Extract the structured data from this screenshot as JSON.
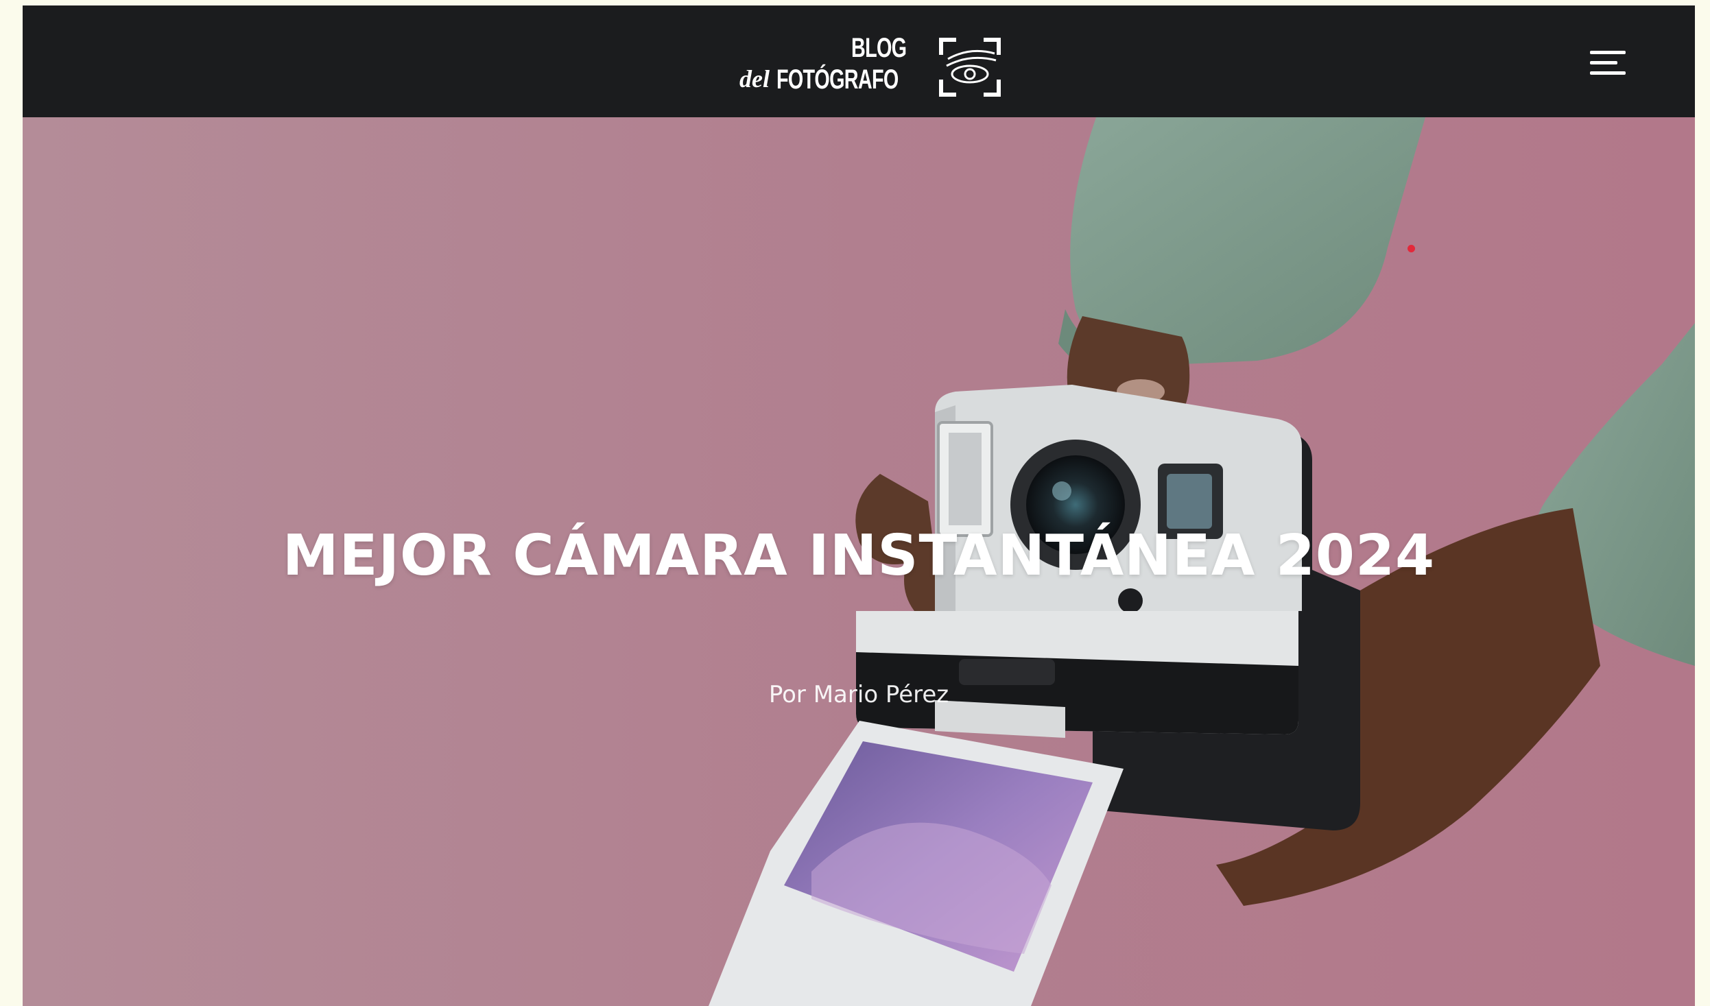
{
  "header": {
    "logo_line1": "BLOG",
    "logo_del": "del",
    "logo_line2": "FOTÓGRAFO",
    "menu_icon": "hamburger-menu-icon"
  },
  "hero": {
    "title": "MEJOR CÁMARA INSTANTÁNEA 2024",
    "author": "Por Mario Pérez",
    "image_description_icon": "instant-camera-image"
  },
  "colors": {
    "header_bg": "#1b1c1e",
    "hero_bg": "#b07e8e",
    "page_bg": "#fbfbec",
    "sleeve": "#7f9a8c",
    "accent_dot": "#e3283a"
  }
}
